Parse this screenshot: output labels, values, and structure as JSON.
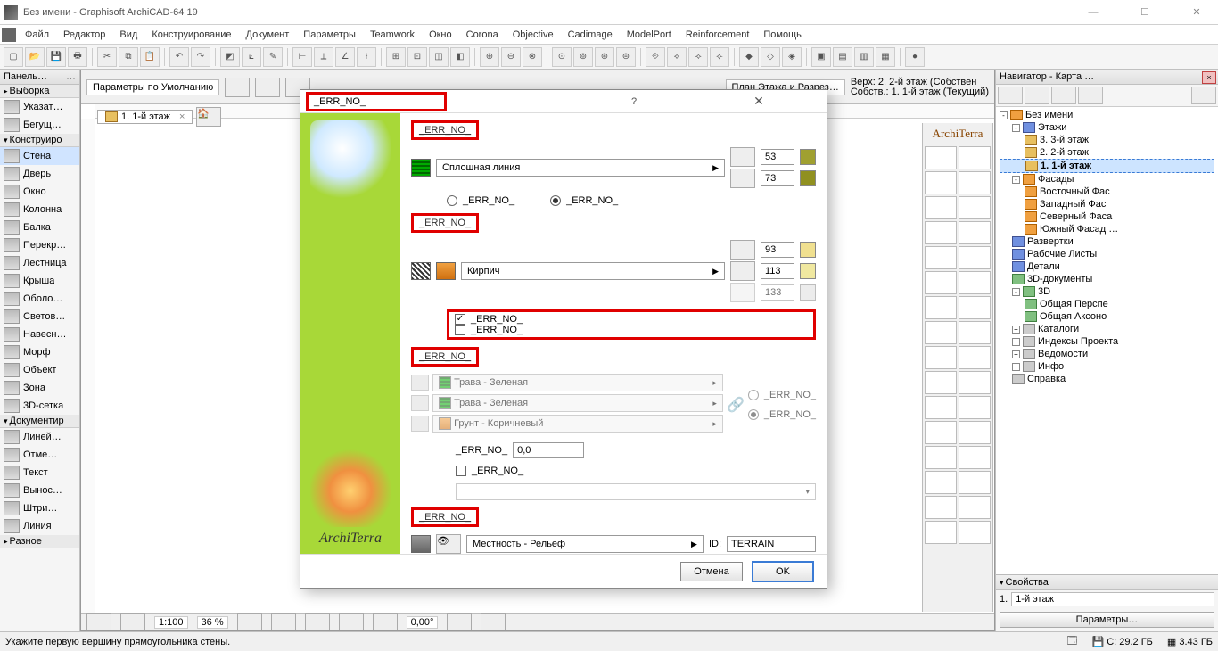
{
  "window": {
    "title": "Без имени - Graphisoft ArchiCAD-64 19"
  },
  "menu": [
    "Файл",
    "Редактор",
    "Вид",
    "Конструирование",
    "Документ",
    "Параметры",
    "Teamwork",
    "Окно",
    "Corona",
    "Objective",
    "Cadimage",
    "ModelPort",
    "Reinforcement",
    "Помощь"
  ],
  "leftpanel": {
    "header": "Панель…",
    "selection": "Выборка",
    "arrow": "Указат…",
    "marquee": "Бегущ…",
    "group_construct": "Конструиро",
    "items": [
      "Стена",
      "Дверь",
      "Окно",
      "Колонна",
      "Балка",
      "Перекр…",
      "Лестница",
      "Крыша",
      "Оболо…",
      "Светов…",
      "Навесн…",
      "Морф",
      "Объект",
      "Зона",
      "3D-сетка"
    ],
    "active": "Стена",
    "group_doc": "Документир",
    "docitems": [
      "Линей…",
      "Отме…",
      "Текст",
      "Вынос…",
      "Штри…",
      "Линия"
    ],
    "more": "Разное"
  },
  "canvas": {
    "params": "Параметры по Умолчанию",
    "plan": "План Этажа и Разрез…",
    "top_right1": "Верх: 2. 2-й этаж (Собствен",
    "top_right2": "Собств.:",
    "top_right3": "1. 1-й этаж",
    "top_right4": "(Текущий)",
    "tab": "1. 1-й этаж",
    "scale": "1:100",
    "zoom": "36 %",
    "angle": "0,00°"
  },
  "dialog": {
    "title": "_ERR_NO_",
    "sidebar_label": "ArchiTerra",
    "sec1": "_ERR_NO_",
    "solid_line": "Сплошная линия",
    "val53": "53",
    "val73": "73",
    "radio1": "_ERR_NO_",
    "radio2": "_ERR_NO_",
    "sec2": "_ERR_NO_",
    "brick": "Кирпич",
    "chk1": "_ERR_NO_",
    "chk2": "_ERR_NO_",
    "val93": "93",
    "val113": "113",
    "val133": "133",
    "sec3": "_ERR_NO_",
    "mat1": "Трава - Зеленая",
    "mat2": "Трава - Зеленая",
    "mat3": "Грунт - Коричневый",
    "radio3": "_ERR_NO_",
    "radio4": "_ERR_NO_",
    "depth_lbl": "_ERR_NO_",
    "depth_val": "0,0",
    "chk3": "_ERR_NO_",
    "sec4": "_ERR_NO_",
    "layer": "Местность - Рельеф",
    "id_lbl": "ID:",
    "id_val": "TERRAIN",
    "cancel": "Отмена",
    "ok": "OK"
  },
  "at_panel": {
    "title": "ArchiTerra"
  },
  "navigator": {
    "header": "Навигатор - Карта …",
    "root": "Без имени",
    "floors": "Этажи",
    "f3": "3. 3-й этаж",
    "f2": "2. 2-й этаж",
    "f1": "1. 1-й этаж",
    "facades": "Фасады",
    "fa1": "Восточный Фас",
    "fa2": "Западный Фас",
    "fa3": "Северный Фаса",
    "fa4": "Южный Фасад …",
    "razv": "Развертки",
    "rab": "Рабочие Листы",
    "det": "Детали",
    "d3doc": "3D-документы",
    "d3": "3D",
    "persp": "Общая Перспе",
    "axon": "Общая Аксоно",
    "cat": "Каталоги",
    "idx": "Индексы Проекта",
    "ved": "Ведомости",
    "info": "Инфо",
    "help": "Справка"
  },
  "props": {
    "header": "Свойства",
    "num": "1.",
    "story": "1-й этаж",
    "params": "Параметры…"
  },
  "status": {
    "hint": "Укажите первую вершину прямоугольника стены.",
    "disk": "C: 29.2 ГБ",
    "ram": "3.43 ГБ"
  }
}
